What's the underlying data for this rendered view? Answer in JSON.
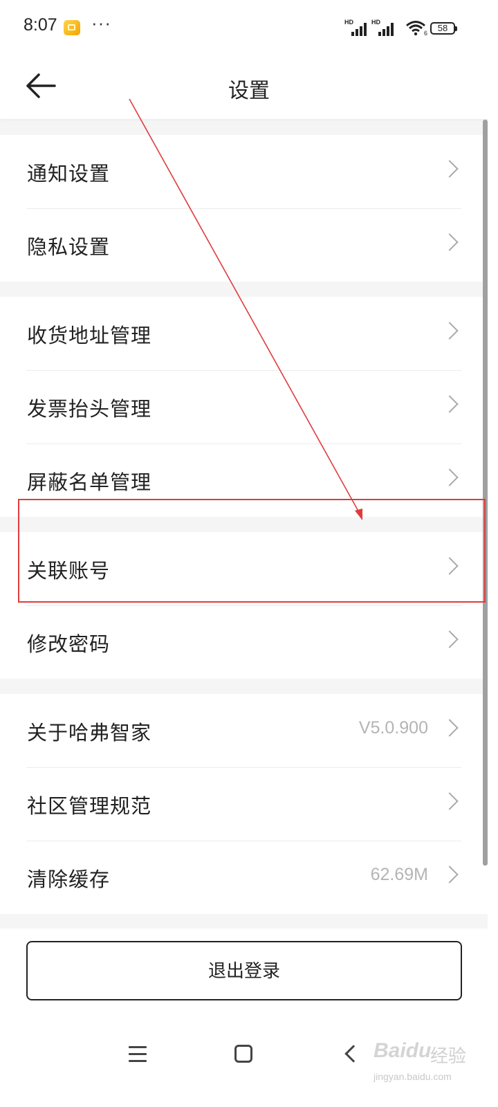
{
  "status_bar": {
    "time": "8:07",
    "dots": "···",
    "signal_label_1": "HD",
    "signal_label_2": "HD",
    "wifi_suffix": "6",
    "battery": "58"
  },
  "header": {
    "title": "设置"
  },
  "groups": [
    {
      "items": [
        {
          "label": "通知设置",
          "value": ""
        },
        {
          "label": "隐私设置",
          "value": ""
        }
      ]
    },
    {
      "items": [
        {
          "label": "收货地址管理",
          "value": ""
        },
        {
          "label": "发票抬头管理",
          "value": ""
        },
        {
          "label": "屏蔽名单管理",
          "value": ""
        }
      ]
    },
    {
      "items": [
        {
          "label": "关联账号",
          "value": ""
        },
        {
          "label": "修改密码",
          "value": ""
        }
      ]
    },
    {
      "items": [
        {
          "label": "关于哈弗智家",
          "value": "V5.0.900"
        },
        {
          "label": "社区管理规范",
          "value": ""
        },
        {
          "label": "清除缓存",
          "value": "62.69M"
        }
      ]
    }
  ],
  "logout_label": "退出登录",
  "watermark": {
    "logo": "Baidu",
    "text": "经验",
    "url": "jingyan.baidu.com"
  },
  "colors": {
    "annotation": "#e03b3b",
    "divider": "#ececec",
    "chevron": "#a9a9a9",
    "secondary_text": "#b4b4b4"
  }
}
